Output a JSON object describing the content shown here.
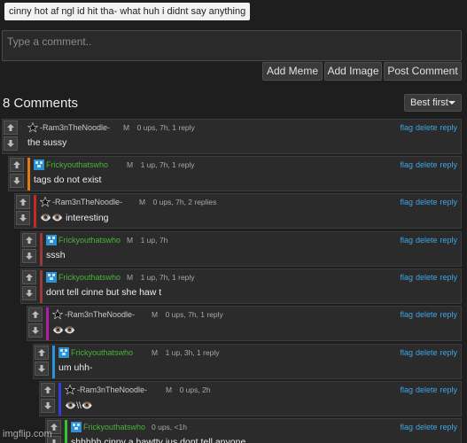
{
  "post": {
    "tags_text": "cinny hot af ngl id hit tha- what huh i didnt say anything"
  },
  "composer": {
    "placeholder": "Type a comment..",
    "add_meme": "Add Meme",
    "add_image": "Add Image",
    "post_comment": "Post Comment"
  },
  "comments_header": {
    "count_label": "8 Comments",
    "sort_label": "Best first"
  },
  "comments": [
    {
      "user": "-Ram3nTheNoodle-",
      "rank": "M",
      "meta": "0 ups, 7h, 1 reply",
      "text": "the sussy",
      "bar_color": "",
      "avatar": "star-icon",
      "user_color": "#c9c9c9"
    },
    {
      "user": "Frickyouthatswho",
      "rank": "M",
      "meta": "1 up, 7h, 1 reply",
      "text": "tags do not exist",
      "bar_color": "#e07b12",
      "avatar": "pixel-avatar-icon",
      "user_color": "#49b33a"
    },
    {
      "user": "-Ram3nTheNoodle-",
      "rank": "M",
      "meta": "0 ups, 7h, 2 replies",
      "text": "👁️👁️ interesting",
      "bar_color": "#c02a2a",
      "avatar": "star-icon",
      "user_color": "#c9c9c9"
    },
    {
      "user": "Frickyouthatswho",
      "rank": "M",
      "meta": "1 up, 7h",
      "text": "sssh",
      "bar_color": "#9b3a3a",
      "avatar": "pixel-avatar-icon",
      "user_color": "#49b33a"
    },
    {
      "user": "Frickyouthatswho",
      "rank": "M",
      "meta": "1 up, 7h, 1 reply",
      "text": "dont tell cinne but she haw t",
      "bar_color": "#9b3a3a",
      "avatar": "pixel-avatar-icon",
      "user_color": "#49b33a"
    },
    {
      "user": "-Ram3nTheNoodle-",
      "rank": "M",
      "meta": "0 ups, 7h, 1 reply",
      "text": "👁️👁️",
      "bar_color": "#b21ca6",
      "avatar": "star-icon",
      "user_color": "#c9c9c9"
    },
    {
      "user": "Frickyouthatswho",
      "rank": "M",
      "meta": "1 up, 3h, 1 reply",
      "text": "um uhh-",
      "bar_color": "#2c93e0",
      "avatar": "pixel-avatar-icon",
      "user_color": "#49b33a"
    },
    {
      "user": "-Ram3nTheNoodle-",
      "rank": "M",
      "meta": "0 ups, 2h",
      "text": "👁️\\\\👁️",
      "bar_color": "#3140d4",
      "avatar": "star-icon",
      "user_color": "#c9c9c9"
    },
    {
      "user": "Frickyouthatswho",
      "rank": "",
      "meta": "0 ups, <1h",
      "text": "shhhhh cinny a hawtty jus dont tell anyone",
      "bar_color": "#32c632",
      "avatar": "pixel-avatar-icon",
      "user_color": "#49b33a"
    }
  ],
  "action_labels": {
    "flag": "flag",
    "delete": "delete",
    "reply": "reply"
  },
  "watermark": "imgflip.com",
  "colors": {
    "link": "#3ea6e6",
    "background": "#1e1e1e",
    "panel": "#2b2b2b"
  }
}
